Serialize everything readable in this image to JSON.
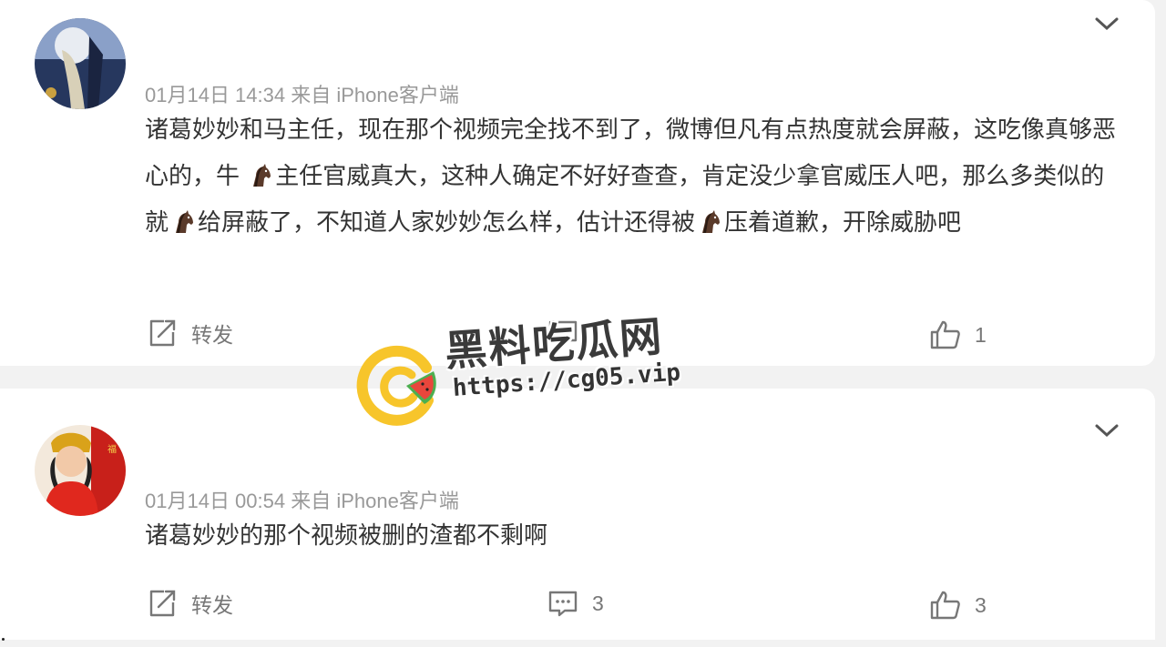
{
  "comments": [
    {
      "meta": "01月14日 14:34  来自 iPhone客户端",
      "text_parts": [
        "诸葛妙妙和马主任，现在那个视频完全找不到了，微博但凡有点热度就会屏蔽，这吃像真够恶心的，牛 ",
        "主任官威真大，这种人确定不好好查查，肯定没少拿官威压人吧，那么多类似的就",
        "给屏蔽了，不知道人家妙妙怎么样，估计还得被",
        "压着道歉，开除威胁吧"
      ],
      "emoji": "horse-emoji",
      "repost_label": "转发",
      "comment_count": "",
      "like_count": "1"
    },
    {
      "meta": "01月14日 00:54  来自 iPhone客户端",
      "text": "诸葛妙妙的那个视频被删的渣都不剩啊",
      "repost_label": "转发",
      "comment_count": "3",
      "like_count": "3"
    }
  ],
  "watermark": {
    "title": "黑料吃瓜网",
    "url": "https://cg05.vip"
  },
  "icons": {
    "repost": "repost-icon",
    "comment": "comment-icon",
    "like": "thumbs-up-icon",
    "expand": "chevron-down-icon"
  },
  "colors": {
    "meta": "#999999",
    "body": "#333333",
    "logo_yellow": "#f7c52b",
    "logo_green": "#4caf50"
  }
}
